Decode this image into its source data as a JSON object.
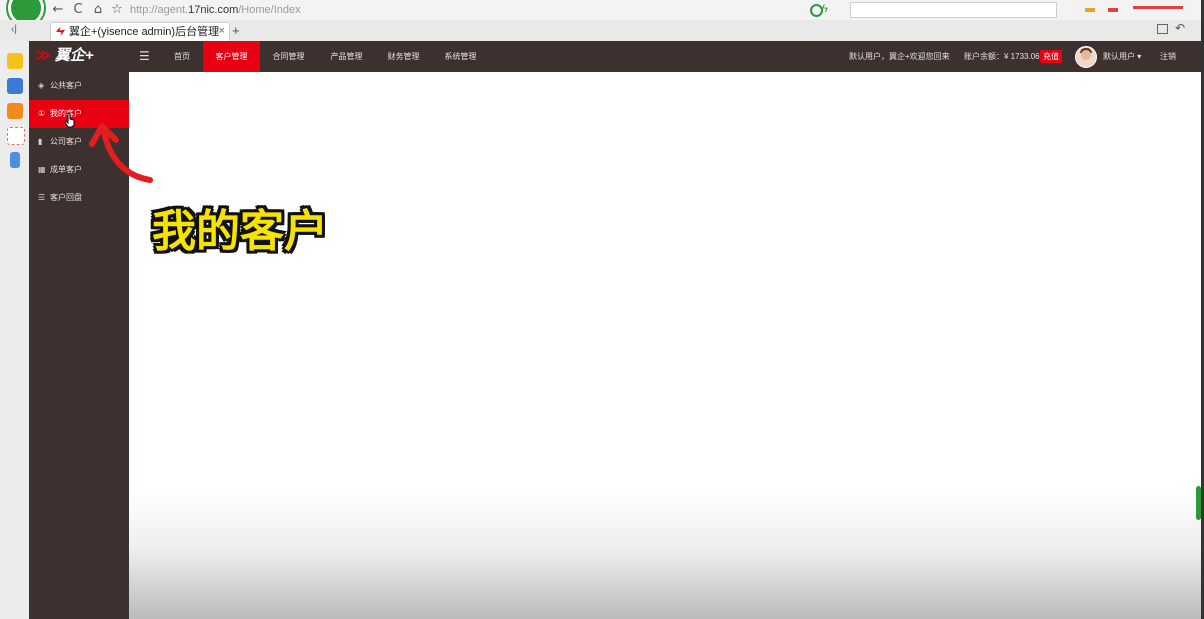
{
  "browser": {
    "url_prefix": "http://agent.",
    "url_domain": "17nic.com",
    "url_path": "/Home/Index",
    "tab_title": "翼企+(yisence admin)后台管理",
    "tab_close": "×",
    "new_tab": "+",
    "back_icon": "arrow-left-icon",
    "refresh_icon": "refresh-icon",
    "home_icon": "home-icon",
    "star_icon": "star-icon",
    "back_glyph": "←",
    "refresh_glyph": "C",
    "home_glyph": "⌂",
    "star_glyph": "☆",
    "sidebar_toggle_glyph": "‹|"
  },
  "app": {
    "brand": "翼企+",
    "menu_toggle_glyph": "☰",
    "nav": [
      {
        "label": "首页",
        "active": false
      },
      {
        "label": "客户管理",
        "active": true
      },
      {
        "label": "合同管理",
        "active": false
      },
      {
        "label": "产品管理",
        "active": false
      },
      {
        "label": "财务管理",
        "active": false
      },
      {
        "label": "系统管理",
        "active": false
      }
    ],
    "welcome": "默认用户，翼企+欢迎您回来",
    "balance": "账户余额：¥ 1733.06",
    "recharge": "充值",
    "user": "默认用户 ▾",
    "logout": "注销",
    "sidebar": [
      {
        "label": "公共客户",
        "icon": "cube-icon",
        "glyph": "◈",
        "active": false
      },
      {
        "label": "我的客户",
        "icon": "user-circle-icon",
        "glyph": "①",
        "active": true
      },
      {
        "label": "公司客户",
        "icon": "bar-chart-icon",
        "glyph": "▮",
        "active": false
      },
      {
        "label": "成单客户",
        "icon": "table-icon",
        "glyph": "▦",
        "active": false
      },
      {
        "label": "客户回盘",
        "icon": "sliders-icon",
        "glyph": "☰",
        "active": false
      }
    ]
  },
  "overlay": {
    "caption": "我的客户"
  },
  "colors": {
    "nav_bg": "#3d3130",
    "accent": "#e60012",
    "caption": "#f6e300",
    "browser_green": "#2c9a3a"
  }
}
